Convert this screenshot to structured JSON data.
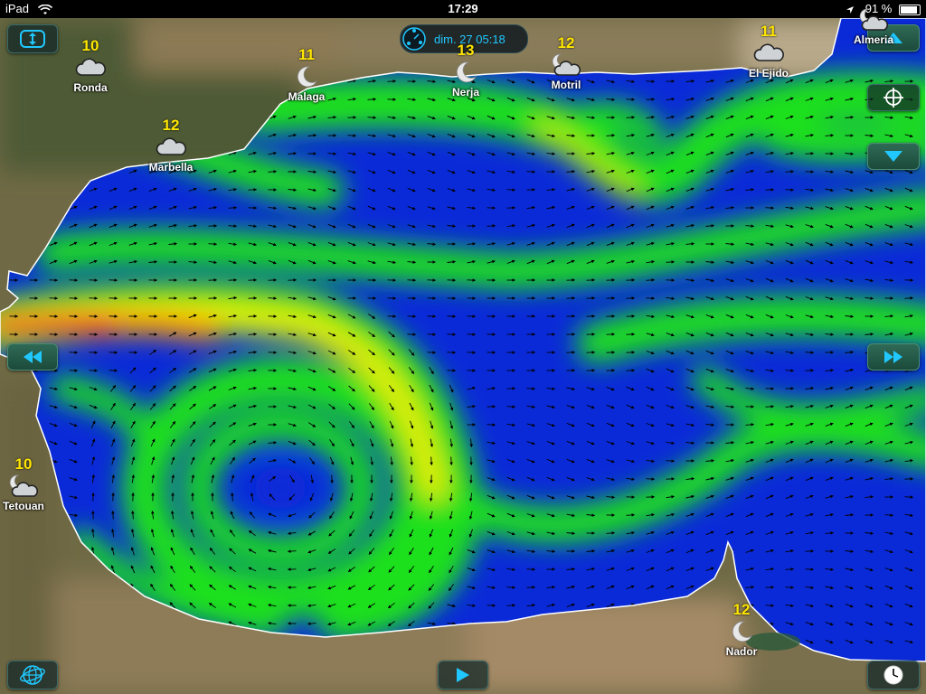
{
  "status_bar": {
    "device": "iPad",
    "time": "17:29",
    "battery": "91 %",
    "battery_level": 0.91
  },
  "time_display": {
    "label": "dim. 27 05:18"
  },
  "controls": {
    "top_left": "arrows-vertical-icon",
    "up": "triangle-up-icon",
    "locate": "crosshair-icon",
    "down": "triangle-down-icon",
    "rewind": "rewind-icon",
    "fast_forward": "fast-forward-icon",
    "globe": "globe-icon",
    "play": "play-icon",
    "clock": "clock-icon"
  },
  "cities": [
    {
      "name": "Ronda",
      "temp": "10",
      "icon": "cloud-icon"
    },
    {
      "name": "Malaga",
      "temp": "11",
      "icon": "moon-icon"
    },
    {
      "name": "Marbella",
      "temp": "12",
      "icon": "cloud-icon"
    },
    {
      "name": "Nerja",
      "temp": "13",
      "icon": "moon-icon"
    },
    {
      "name": "Motril",
      "temp": "12",
      "icon": "moon-cloud-icon"
    },
    {
      "name": "El Ejido",
      "temp": "11",
      "icon": "cloud-icon"
    },
    {
      "name": "Almeria",
      "temp": "",
      "icon": "moon-cloud-icon"
    },
    {
      "name": "Tetouan",
      "temp": "10",
      "icon": "moon-cloud-icon"
    },
    {
      "name": "Nador",
      "temp": "12",
      "icon": "moon-icon"
    }
  ],
  "colors": {
    "low": "#0a2ad8",
    "mid": "#1ee01e",
    "high": "#ffff00",
    "peak": "#ff2020",
    "accent": "#20c8ff",
    "temperature": "#ffe600"
  }
}
